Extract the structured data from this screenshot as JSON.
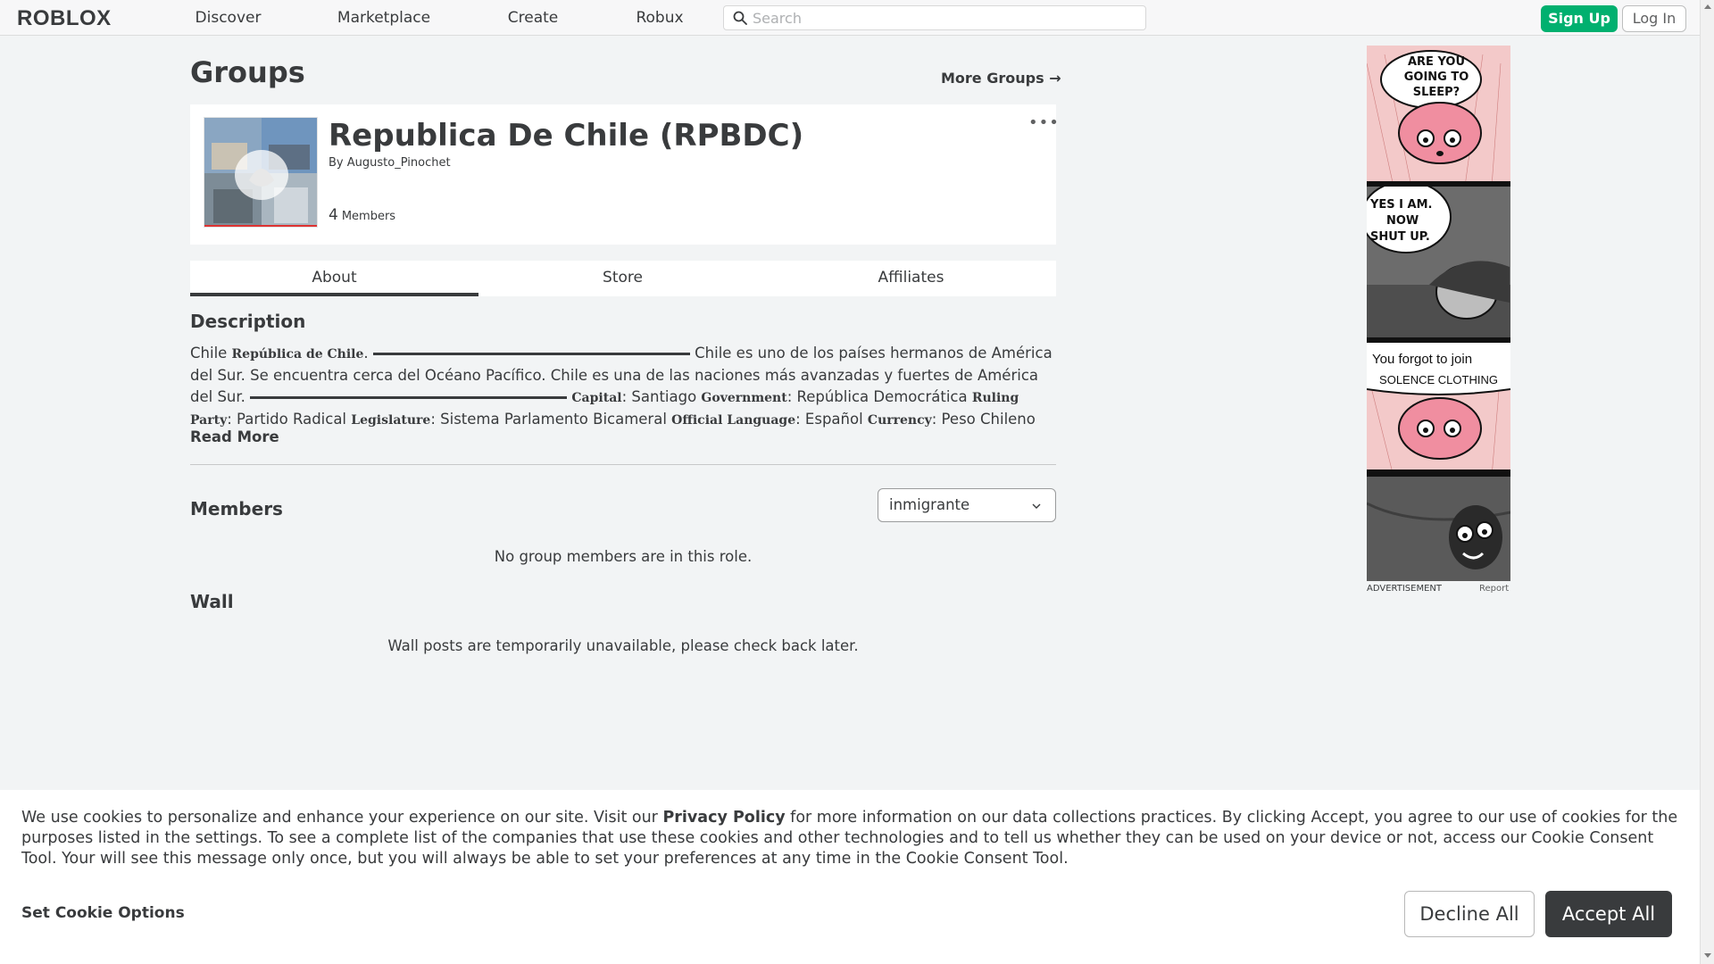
{
  "nav": {
    "logo": "ROBLOX",
    "links": [
      "Discover",
      "Marketplace",
      "Create",
      "Robux"
    ],
    "search_placeholder": "Search",
    "signup": "Sign Up",
    "login": "Log In"
  },
  "page": {
    "title": "Groups",
    "more_groups": "More Groups",
    "more_groups_arrow": "→"
  },
  "group": {
    "name": "Republica De Chile (RPBDC)",
    "by_label": "By",
    "owner": "Augusto_Pinochet",
    "member_count": "4",
    "members_label": "Members",
    "menu_dots": "•••"
  },
  "tabs": [
    "About",
    "Store",
    "Affiliates"
  ],
  "description": {
    "heading": "Description",
    "p1_a": "Chile ",
    "p1_b": "República de Chile",
    "p1_c": ". ",
    "p1_d": " Chile es uno de los países hermanos de América del Sur. Se encuentra cerca del Océano Pacífico. Chile es una de las naciones más avanzadas y fuertes de América del Sur. ",
    "k_capital": "Capital",
    "v_capital": ": Santiago ",
    "k_government": "Government",
    "v_government": ": República Democrática ",
    "k_ruling": "Ruling Party",
    "v_ruling": ": Partido Radical ",
    "k_legislature": "Legislature",
    "v_legislature": ": Sistema Parlamento Bicameral ",
    "k_language": "Official Language",
    "v_language": ": Español ",
    "k_currency": "Currency",
    "v_currency": ": Peso Chileno",
    "read_more": "Read More"
  },
  "members": {
    "heading": "Members",
    "role_selected": "inmigrante",
    "empty": "No group members are in this role."
  },
  "wall": {
    "heading": "Wall",
    "empty": "Wall posts are temporarily unavailable, please check back later."
  },
  "ad": {
    "panel1": "ARE YOU GOING TO SLEEP?",
    "panel2_l1": "YES I AM.",
    "panel2_l2": "NOW",
    "panel2_l3": "SHUT UP.",
    "panel3_l1": "You forgot to join",
    "panel3_l2": "SOLENCE CLOTHING",
    "label": "ADVERTISEMENT",
    "report": "Report"
  },
  "cookie": {
    "text_a": "We use cookies to personalize and enhance your experience on our site. Visit our ",
    "privacy": "Privacy Policy",
    "text_b": " for more information on our data collections practices. By clicking Accept, you agree to our use of cookies for the purposes listed in the settings. To see a complete list of the companies that use these cookies and other technologies and to tell us whether they can be used on your device or not, access our Cookie Consent Tool. Your will see this message only once, but you will always be able to set your preferences at any time in the Cookie Consent Tool.",
    "options": "Set Cookie Options",
    "decline": "Decline All",
    "accept": "Accept All"
  },
  "colors": {
    "signup_green": "#00b06f",
    "accept_dark": "#393b3d",
    "page_bg": "#f2f4f5"
  }
}
